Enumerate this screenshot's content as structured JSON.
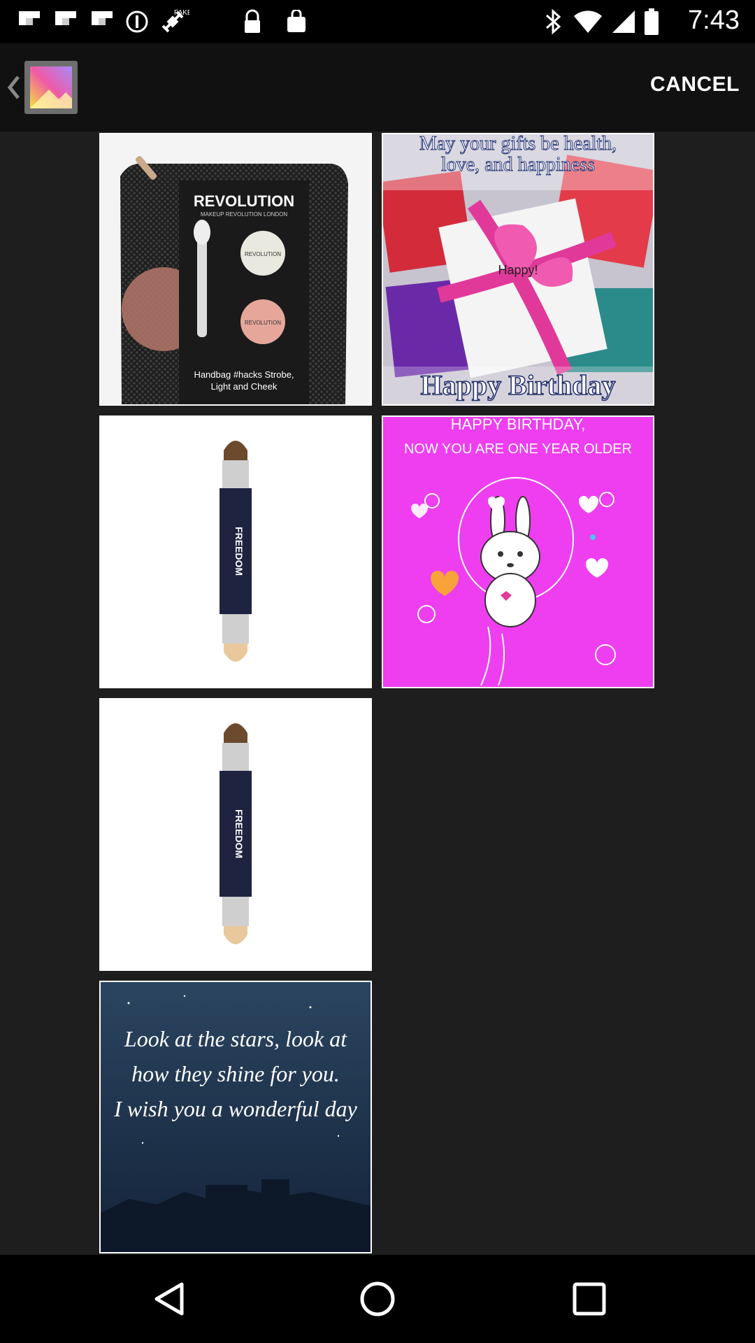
{
  "status_bar": {
    "time": "7:43",
    "left_icons": [
      "flipboard-icon",
      "flipboard-icon",
      "flipboard-icon",
      "record-icon",
      "fake-gps-icon",
      "lock-icon",
      "bag-icon"
    ],
    "right_icons": [
      "bluetooth-icon",
      "wifi-icon",
      "signal-icon",
      "battery-icon"
    ]
  },
  "action_bar": {
    "cancel_label": "CANCEL",
    "app_icon": "gallery-icon"
  },
  "tiles": [
    {
      "kind": "makeup-pouch",
      "brand": "REVOLUTION",
      "subbrand": "MAKEUP REVOLUTION LONDON",
      "badge": "REVOLUTION",
      "caption_line1": "Handbag #hacks Strobe,",
      "caption_line2": "Light and Cheek"
    },
    {
      "kind": "gift-card",
      "top_line1": "May your gifts be health,",
      "top_line2": "love, and happiness",
      "middle": "Happy!",
      "bottom": "Happy Birthday"
    },
    {
      "kind": "contour-stick",
      "label": "FREEDOM"
    },
    {
      "kind": "bunny-card",
      "line1": "HAPPY BIRTHDAY,",
      "line2": "NOW YOU ARE ONE YEAR OLDER",
      "bg_color": "#ee3ef0"
    },
    {
      "kind": "contour-stick",
      "label": "FREEDOM"
    },
    {
      "kind": "stars-card",
      "line1": "Look at the stars, look at",
      "line2": "how they shine for you.",
      "line3": "I wish you a wonderful day"
    }
  ],
  "nav_bar": {
    "back": "back-triangle-icon",
    "home": "home-circle-icon",
    "recents": "recents-square-icon"
  }
}
